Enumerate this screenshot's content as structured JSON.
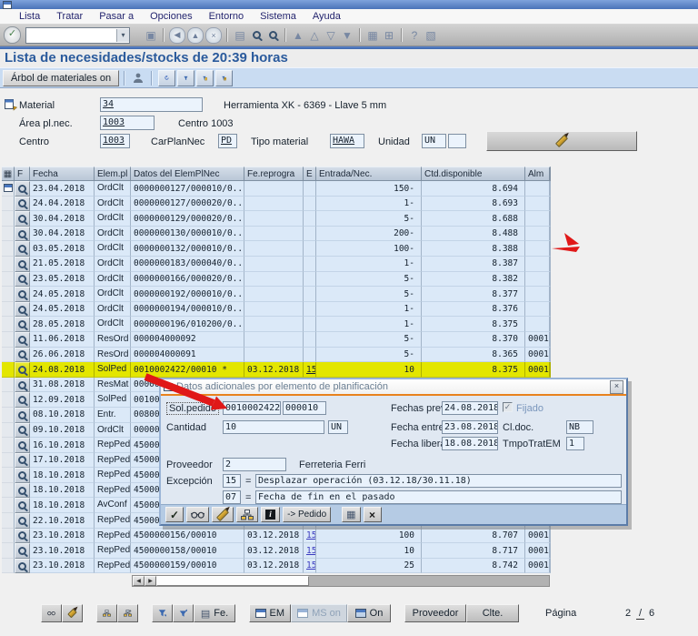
{
  "menu": {
    "items": [
      "Lista",
      "Tratar",
      "Pasar a",
      "Opciones",
      "Entorno",
      "Sistema",
      "Ayuda"
    ]
  },
  "std_toolbar": {
    "command_field_value": "",
    "items": [
      {
        "name": "enter-button",
        "type": "check"
      },
      {
        "name": "command-field",
        "type": "input"
      },
      {
        "name": "save-icon",
        "glyph": "▣"
      },
      {
        "name": "separator"
      },
      {
        "name": "back-icon",
        "glyph": "◀",
        "circle": true
      },
      {
        "name": "exit-icon",
        "glyph": "▲",
        "circle": true
      },
      {
        "name": "cancel-icon",
        "glyph": "×",
        "circle": true
      },
      {
        "name": "separator"
      },
      {
        "name": "print-icon",
        "glyph": "▤"
      },
      {
        "name": "find-icon",
        "shape": "mag"
      },
      {
        "name": "find-next-icon",
        "shape": "mag"
      },
      {
        "name": "separator"
      },
      {
        "name": "first-page-icon",
        "glyph": "▲"
      },
      {
        "name": "page-up-icon",
        "glyph": "△"
      },
      {
        "name": "page-down-icon",
        "glyph": "▽"
      },
      {
        "name": "last-page-icon",
        "glyph": "▼"
      },
      {
        "name": "separator"
      },
      {
        "name": "create-shortcut-icon",
        "glyph": "▦"
      },
      {
        "name": "new-session-icon",
        "glyph": "⊞"
      },
      {
        "name": "separator"
      },
      {
        "name": "help-icon",
        "glyph": "?"
      },
      {
        "name": "customize-icon",
        "glyph": "▧"
      }
    ]
  },
  "page": {
    "title": "Lista de necesidades/stocks de 20:39 horas"
  },
  "app_toolbar": {
    "materials_tree_button": "Árbol de materiales on"
  },
  "header_fields": {
    "material_label": "Material",
    "material_value": "34",
    "material_description": "Herramienta XK - 6369 - Llave 5 mm",
    "area_label": "Área pl.nec.",
    "area_value": "1003",
    "area_description": "Centro 1003",
    "centro_label": "Centro",
    "centro_value": "1003",
    "carplannec_label": "CarPlanNec",
    "carplannec_value": "PD",
    "tipo_material_label": "Tipo material",
    "tipo_material_value": "HAWA",
    "unidad_label": "Unidad",
    "unidad_value": "UN",
    "unidad_extra_value": ""
  },
  "table": {
    "columns": [
      "F",
      "Fecha",
      "Elem.pl",
      "Datos del ElemPlNec",
      "Fe.reprogra",
      "E",
      "Entrada/Nec.",
      "Ctd.disponible",
      "Alm"
    ],
    "rows": [
      {
        "fecha": "23.04.2018",
        "elem": "OrdClt",
        "datos": "0000000127/000010/0..",
        "fe": "",
        "e": "",
        "entrada": "150-",
        "ctd": "8.694",
        "alm": ""
      },
      {
        "fecha": "24.04.2018",
        "elem": "OrdClt",
        "datos": "0000000127/000020/0..",
        "fe": "",
        "e": "",
        "entrada": "1-",
        "ctd": "8.693",
        "alm": ""
      },
      {
        "fecha": "30.04.2018",
        "elem": "OrdClt",
        "datos": "0000000129/000020/0..",
        "fe": "",
        "e": "",
        "entrada": "5-",
        "ctd": "8.688",
        "alm": ""
      },
      {
        "fecha": "30.04.2018",
        "elem": "OrdClt",
        "datos": "0000000130/000010/0..",
        "fe": "",
        "e": "",
        "entrada": "200-",
        "ctd": "8.488",
        "alm": ""
      },
      {
        "fecha": "03.05.2018",
        "elem": "OrdClt",
        "datos": "0000000132/000010/0..",
        "fe": "",
        "e": "",
        "entrada": "100-",
        "ctd": "8.388",
        "alm": ""
      },
      {
        "fecha": "21.05.2018",
        "elem": "OrdClt",
        "datos": "0000000183/000040/0..",
        "fe": "",
        "e": "",
        "entrada": "1-",
        "ctd": "8.387",
        "alm": ""
      },
      {
        "fecha": "23.05.2018",
        "elem": "OrdClt",
        "datos": "0000000166/000020/0..",
        "fe": "",
        "e": "",
        "entrada": "5-",
        "ctd": "8.382",
        "alm": ""
      },
      {
        "fecha": "24.05.2018",
        "elem": "OrdClt",
        "datos": "0000000192/000010/0..",
        "fe": "",
        "e": "",
        "entrada": "5-",
        "ctd": "8.377",
        "alm": ""
      },
      {
        "fecha": "24.05.2018",
        "elem": "OrdClt",
        "datos": "0000000194/000010/0..",
        "fe": "",
        "e": "",
        "entrada": "1-",
        "ctd": "8.376",
        "alm": ""
      },
      {
        "fecha": "28.05.2018",
        "elem": "OrdClt",
        "datos": "0000000196/010200/0..",
        "fe": "",
        "e": "",
        "entrada": "1-",
        "ctd": "8.375",
        "alm": ""
      },
      {
        "fecha": "11.06.2018",
        "elem": "ResOrd",
        "datos": "000004000092",
        "fe": "",
        "e": "",
        "entrada": "5-",
        "ctd": "8.370",
        "alm": "0001"
      },
      {
        "fecha": "26.06.2018",
        "elem": "ResOrd",
        "datos": "000004000091",
        "fe": "",
        "e": "",
        "entrada": "5-",
        "ctd": "8.365",
        "alm": "0001"
      },
      {
        "fecha": "24.08.2018",
        "elem": "SolPed",
        "datos": "0010002422/00010 *",
        "fe": "03.12.2018",
        "e": "15",
        "entrada": "10",
        "ctd": "8.375",
        "alm": "0001",
        "highlight": true
      },
      {
        "fecha": "31.08.2018",
        "elem": "ResMat",
        "datos": "000000",
        "fe": "",
        "e": "",
        "entrada": "",
        "ctd": "",
        "alm": ""
      },
      {
        "fecha": "12.09.2018",
        "elem": "SolPed",
        "datos": "001000",
        "fe": "",
        "e": "",
        "entrada": "",
        "ctd": "",
        "alm": ""
      },
      {
        "fecha": "08.10.2018",
        "elem": "Entr.",
        "datos": "008000",
        "fe": "",
        "e": "",
        "entrada": "",
        "ctd": "",
        "alm": ""
      },
      {
        "fecha": "09.10.2018",
        "elem": "OrdClt",
        "datos": "000000",
        "fe": "",
        "e": "",
        "entrada": "",
        "ctd": "",
        "alm": ""
      },
      {
        "fecha": "16.10.2018",
        "elem": "RepPed",
        "datos": "450000",
        "fe": "",
        "e": "",
        "entrada": "",
        "ctd": "",
        "alm": ""
      },
      {
        "fecha": "17.10.2018",
        "elem": "RepPed",
        "datos": "450000",
        "fe": "",
        "e": "",
        "entrada": "",
        "ctd": "",
        "alm": ""
      },
      {
        "fecha": "18.10.2018",
        "elem": "RepPed",
        "datos": "450000",
        "fe": "",
        "e": "",
        "entrada": "",
        "ctd": "",
        "alm": ""
      },
      {
        "fecha": "18.10.2018",
        "elem": "RepPed",
        "datos": "450000",
        "fe": "",
        "e": "",
        "entrada": "",
        "ctd": "",
        "alm": ""
      },
      {
        "fecha": "18.10.2018",
        "elem": "AvConf",
        "datos": "450000",
        "fe": "",
        "e": "",
        "entrada": "",
        "ctd": "",
        "alm": ""
      },
      {
        "fecha": "22.10.2018",
        "elem": "RepPed",
        "datos": "450000",
        "fe": "",
        "e": "",
        "entrada": "",
        "ctd": "",
        "alm": ""
      },
      {
        "fecha": "23.10.2018",
        "elem": "RepPed",
        "datos": "4500000156/00010",
        "fe": "03.12.2018",
        "e": "15",
        "entrada": "100",
        "ctd": "8.707",
        "alm": "0001"
      },
      {
        "fecha": "23.10.2018",
        "elem": "RepPed",
        "datos": "4500000158/00010",
        "fe": "03.12.2018",
        "e": "15",
        "entrada": "10",
        "ctd": "8.717",
        "alm": "0001"
      },
      {
        "fecha": "23.10.2018",
        "elem": "RepPed",
        "datos": "4500000159/00010",
        "fe": "03.12.2018",
        "e": "15",
        "entrada": "25",
        "ctd": "8.742",
        "alm": "0001"
      }
    ]
  },
  "dialog": {
    "title": "Datos adicionales por elemento de planificación",
    "solpedido_label": "Sol.pedido",
    "solpedido_number": "0010002422",
    "solpedido_item": "000010",
    "fechas_previst_label": "Fechas previst.",
    "fechas_previst": "24.08.2018",
    "fijado_label": "Fijado",
    "cantidad_label": "Cantidad",
    "cantidad": "10",
    "cantidad_um": "UN",
    "fecha_entrega_label": "Fecha entrega",
    "fecha_entrega": "23.08.2018",
    "cl_doc_label": "Cl.doc.",
    "cl_doc": "NB",
    "fecha_liberac_label": "Fecha liberac.",
    "fecha_liberac": "18.08.2018",
    "tmpo_trat_em_label": "TmpoTratEM",
    "tmpo_trat_em": "1",
    "proveedor_label": "Proveedor",
    "proveedor": "2",
    "proveedor_nombre": "Ferreteria Ferri",
    "excepcion_label": "Excepción",
    "igual": "=",
    "excepcion_1_codigo": "15",
    "excepcion_1_texto": "Desplazar operación (03.12.18/30.11.18)",
    "excepcion_2_codigo": "07",
    "excepcion_2_texto": "Fecha de fin en el pasado",
    "pedido_button": "-> Pedido"
  },
  "footer": {
    "fe": "Fe.",
    "em": "EM",
    "ms_on": "MS on",
    "on": "On",
    "proveedor": "Proveedor",
    "clte": "Clte.",
    "pagina_label": "Página",
    "pagina_actual": "2",
    "pagina_sep": "/",
    "pagina_total": "6"
  },
  "icons": {
    "check": "✓",
    "close": "×",
    "grid": "▦",
    "corner": "▦",
    "printer": "▤",
    "scroll_left": "◀",
    "scroll_right": "▶",
    "funnel_down": "▼",
    "funnel_up": "▲",
    "info": "i"
  },
  "colors": {
    "highlight_row": "#e3e600",
    "dialog_titlebar_accent": "#e8821e",
    "annotation_red": "#e01818",
    "app_toolbar_bg": "#c9dcf2",
    "table_row_bg": "#dbe9f8",
    "page_title": "#2a5a9c"
  }
}
